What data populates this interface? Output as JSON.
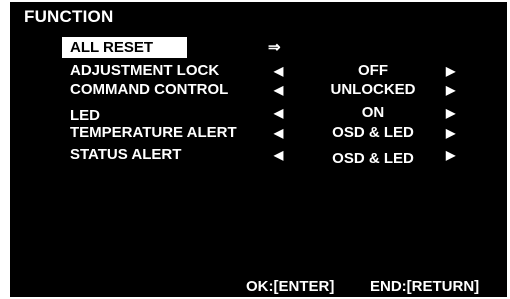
{
  "menu": {
    "title": "FUNCTION",
    "items": [
      {
        "label": "ALL RESET",
        "value": "",
        "action": "⇒"
      },
      {
        "label": "ADJUSTMENT LOCK",
        "value": "OFF"
      },
      {
        "label": "COMMAND CONTROL",
        "value": "UNLOCKED"
      },
      {
        "label": "LED",
        "value": "ON"
      },
      {
        "label": "TEMPERATURE ALERT",
        "value": "OSD & LED"
      },
      {
        "label": "STATUS ALERT",
        "value": "OSD & LED"
      }
    ],
    "arrow_left": "◀",
    "arrow_right": "▶"
  },
  "footer": {
    "ok_hint": "OK:[ENTER]",
    "end_hint": "END:[RETURN]"
  },
  "colors": {
    "background": "#000000",
    "text": "#ffffff",
    "highlight": "#ffffff",
    "highlight_text": "#000000"
  }
}
